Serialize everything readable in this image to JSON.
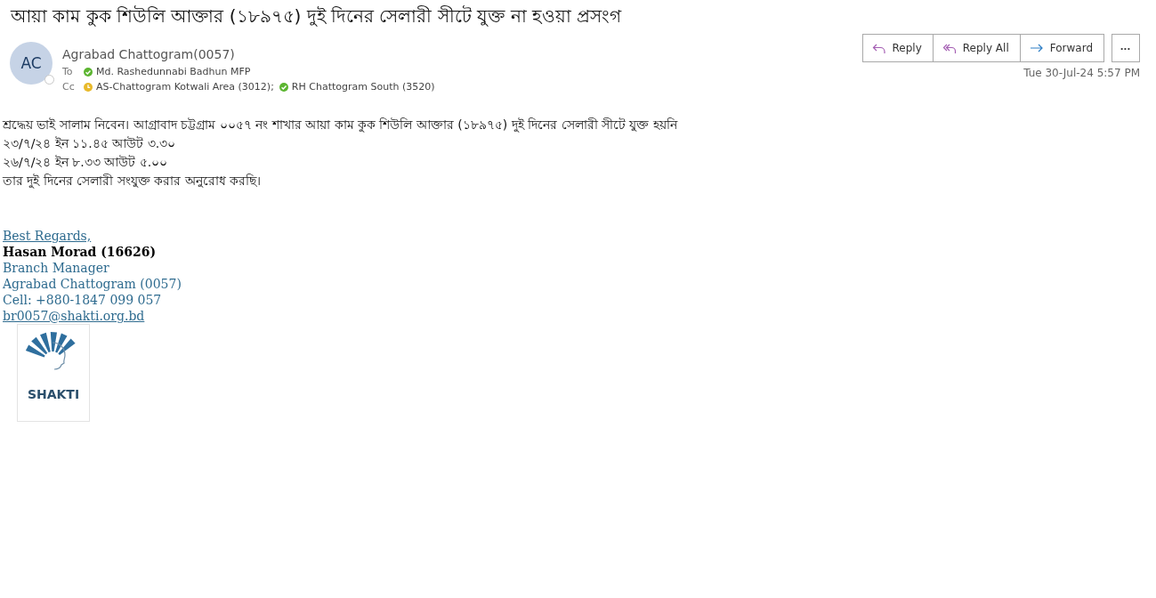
{
  "subject": "আয়া কাম কুক শিউলি আক্তার (১৮৯৭৫)  দুই দিনের সেলারী সীটে যুক্ত না হওয়া প্রসংগ",
  "sender": {
    "initials": "AC",
    "name": "Agrabad  Chattogram(0057)"
  },
  "to": {
    "label": "To",
    "recipients": [
      {
        "name": "Md. Rashedunnabi Badhun MFP",
        "kind": "available",
        "color": "#5cb531"
      }
    ]
  },
  "cc": {
    "label": "Cc",
    "recipients": [
      {
        "name": "AS-Chattogram  Kotwali Area (3012);",
        "kind": "away",
        "color": "#e8b92a"
      },
      {
        "name": "RH Chattogram South (3520)",
        "kind": "available",
        "color": "#5cb531"
      }
    ]
  },
  "actions": [
    {
      "label": "Reply",
      "kind": "reply"
    },
    {
      "label": "Reply All",
      "kind": "reply-all"
    },
    {
      "label": "Forward",
      "kind": "forward"
    }
  ],
  "more_button": "•••",
  "date": "Tue 30-Jul-24 5:57 PM",
  "body": [
    "শ্রদ্ধেয় ভাই সালাম নিবেন। আগ্রাবাদ চট্টগ্রাম ০০৫৭ নং শাখার আয়া কাম কুক শিউলি আক্তার (১৮৯৭৫) দুই দিনের সেলারী সীটে যুক্ত হয়নি",
    "২৩/৭/২৪ ইন ১১.৪৫ আউট ৩.৩০",
    "২৬/৭/২৪ ইন ৮.৩৩ আউট ৫.০০",
    "তার দুই দিনের সেলারী সংযুক্ত করার অনুরোধ করছি।"
  ],
  "signature": [
    {
      "text": "Best Regards,",
      "kind": "link"
    },
    {
      "text": "Hasan Morad (16626)",
      "kind": "name"
    },
    {
      "text": "Branch Manager",
      "kind": "line"
    },
    {
      "text": "Agrabad Chattogram (0057)",
      "kind": "line"
    },
    {
      "text": "Cell: +880-1847 099 057",
      "kind": "line"
    },
    {
      "text": "br0057@shakti.org.bd",
      "kind": "link"
    }
  ],
  "logo": {
    "wordmark": "SHAKTI"
  }
}
